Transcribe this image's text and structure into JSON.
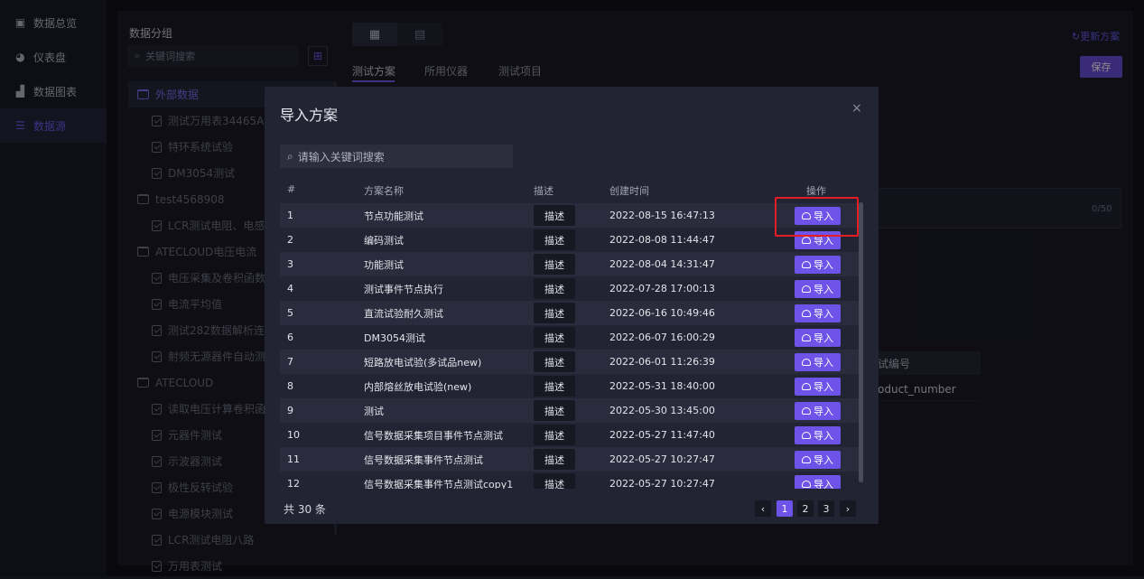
{
  "nav": {
    "items": [
      {
        "label": "数据总览",
        "icon": "overview-icon",
        "active": false
      },
      {
        "label": "仪表盘",
        "icon": "dashboard-icon",
        "active": false
      },
      {
        "label": "数据图表",
        "icon": "bar-chart-icon",
        "active": false
      },
      {
        "label": "数据源",
        "icon": "database-icon",
        "active": true
      }
    ]
  },
  "group": {
    "title": "数据分组",
    "search_placeholder": "关键词搜索",
    "tree": [
      {
        "type": "folder",
        "label": "外部数据",
        "selected": true
      },
      {
        "type": "file",
        "label": "测试万用表34465A"
      },
      {
        "type": "file",
        "label": "特环系统试验"
      },
      {
        "type": "file",
        "label": "DM3054测试"
      },
      {
        "type": "folder",
        "label": "test4568908"
      },
      {
        "type": "file",
        "label": "LCR测试电阻、电感"
      },
      {
        "type": "folder",
        "label": "ATECLOUD电压电流"
      },
      {
        "type": "file",
        "label": "电压采集及卷积函数"
      },
      {
        "type": "file",
        "label": "电流平均值"
      },
      {
        "type": "file",
        "label": "测试282数据解析连"
      },
      {
        "type": "file",
        "label": "射频无源器件自动测"
      },
      {
        "type": "folder",
        "label": "ATECLOUD"
      },
      {
        "type": "file",
        "label": "读取电压计算卷积函"
      },
      {
        "type": "file",
        "label": "元器件测试"
      },
      {
        "type": "file",
        "label": "示波器测试"
      },
      {
        "type": "file",
        "label": "极性反转试验"
      },
      {
        "type": "file",
        "label": "电源模块测试"
      },
      {
        "type": "file",
        "label": "LCR测试电阻八路"
      },
      {
        "type": "file",
        "label": "万用表测试"
      }
    ]
  },
  "content": {
    "tabs": [
      "测试方案",
      "所用仪器",
      "测试项目"
    ],
    "update_label": "更新方案",
    "save_label": "保存",
    "char_count": "0/50",
    "product_header": "试编号",
    "product_value": "oduct_number"
  },
  "modal": {
    "title": "导入方案",
    "close": "×",
    "search_placeholder": "请输入关键词搜索",
    "columns": [
      "#",
      "方案名称",
      "描述",
      "创建时间",
      "操作"
    ],
    "desc_label": "描述",
    "import_label": "导入",
    "rows": [
      {
        "no": "1",
        "name": "节点功能测试",
        "time": "2022-08-15 16:47:13"
      },
      {
        "no": "2",
        "name": "编码测试",
        "time": "2022-08-08 11:44:47"
      },
      {
        "no": "3",
        "name": "功能测试",
        "time": "2022-08-04 14:31:47"
      },
      {
        "no": "4",
        "name": "测试事件节点执行",
        "time": "2022-07-28 17:00:13"
      },
      {
        "no": "5",
        "name": "直流试验耐久测试",
        "time": "2022-06-16 10:49:46"
      },
      {
        "no": "6",
        "name": "DM3054测试",
        "time": "2022-06-07 16:00:29"
      },
      {
        "no": "7",
        "name": "短路放电试验(多试品new)",
        "time": "2022-06-01 11:26:39"
      },
      {
        "no": "8",
        "name": "内部熔丝放电试验(new)",
        "time": "2022-05-31 18:40:00"
      },
      {
        "no": "9",
        "name": "测试",
        "time": "2022-05-30 13:45:00"
      },
      {
        "no": "10",
        "name": "信号数据采集项目事件节点测试",
        "time": "2022-05-27 11:47:40"
      },
      {
        "no": "11",
        "name": "信号数据采集事件节点测试",
        "time": "2022-05-27 10:27:47"
      },
      {
        "no": "12",
        "name": "信号数据采集事件节点测试copy1",
        "time": "2022-05-27 10:27:47"
      }
    ],
    "total": "共 30 条",
    "pages": [
      "1",
      "2",
      "3"
    ],
    "current_page": "1"
  },
  "colors": {
    "accent": "#6d53e8",
    "highlight": "#e51c23"
  }
}
